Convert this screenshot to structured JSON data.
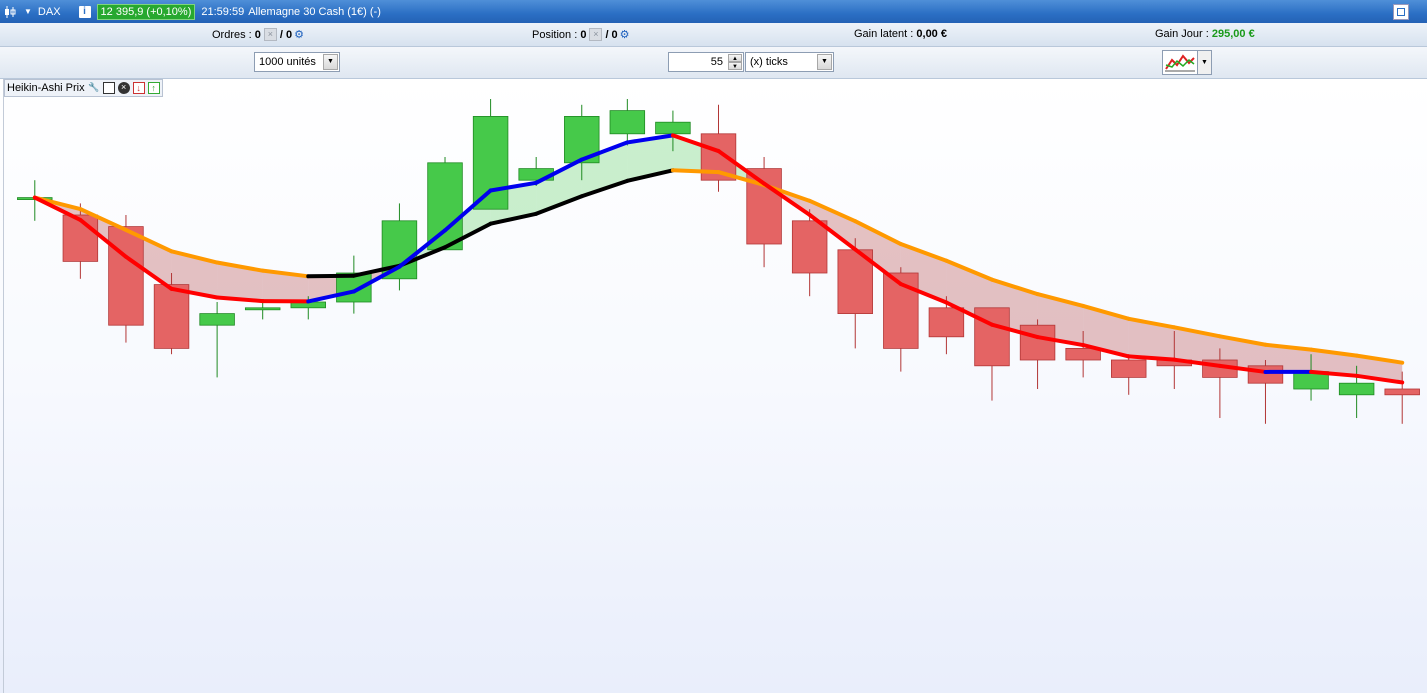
{
  "titlebar": {
    "symbol": "DAX",
    "info_icon": "i",
    "price_badge": "12 395,9 (+0,10%)",
    "clock": "21:59:59",
    "instrument": "Allemagne 30 Cash (1€) (-)"
  },
  "infobar": {
    "orders_label": "Ordres :",
    "orders_value": "0",
    "orders_value2": "/ 0",
    "position_label": "Position :",
    "position_value": "0",
    "position_value2": "/ 0",
    "latent_label": "Gain latent :",
    "latent_value": "0,00 €",
    "day_label": "Gain Jour :",
    "day_value": "295,00 €"
  },
  "toolbar": {
    "units_select": "1000 unités",
    "ticks_value": "55",
    "ticks_select": "(x) ticks"
  },
  "indicator": {
    "label": "Heikin-Ashi Prix"
  },
  "colors": {
    "bull": "#46c94a",
    "bear": "#e46464",
    "ma_fast_up": "#0000ee",
    "ma_fast_down": "#ff0000",
    "ma_slow_up": "#000000",
    "ma_slow_down": "#ff9900"
  },
  "chart_data": {
    "type": "candlestick",
    "candles": [
      {
        "o": 0.83,
        "c": 0.83,
        "h": 0.86,
        "l": 0.79
      },
      {
        "o": 0.8,
        "c": 0.72,
        "h": 0.82,
        "l": 0.69
      },
      {
        "o": 0.78,
        "c": 0.61,
        "h": 0.8,
        "l": 0.58
      },
      {
        "o": 0.68,
        "c": 0.57,
        "h": 0.7,
        "l": 0.56
      },
      {
        "o": 0.61,
        "c": 0.63,
        "h": 0.65,
        "l": 0.52
      },
      {
        "o": 0.64,
        "c": 0.64,
        "h": 0.65,
        "l": 0.62
      },
      {
        "o": 0.64,
        "c": 0.65,
        "h": 0.66,
        "l": 0.62
      },
      {
        "o": 0.65,
        "c": 0.7,
        "h": 0.73,
        "l": 0.63
      },
      {
        "o": 0.69,
        "c": 0.79,
        "h": 0.82,
        "l": 0.67
      },
      {
        "o": 0.74,
        "c": 0.89,
        "h": 0.9,
        "l": 0.74
      },
      {
        "o": 0.81,
        "c": 0.97,
        "h": 1.0,
        "l": 0.81
      },
      {
        "o": 0.86,
        "c": 0.88,
        "h": 0.9,
        "l": 0.85
      },
      {
        "o": 0.89,
        "c": 0.97,
        "h": 0.99,
        "l": 0.86
      },
      {
        "o": 0.94,
        "c": 0.98,
        "h": 1.0,
        "l": 0.92
      },
      {
        "o": 0.94,
        "c": 0.96,
        "h": 0.98,
        "l": 0.91
      },
      {
        "o": 0.94,
        "c": 0.86,
        "h": 0.99,
        "l": 0.84
      },
      {
        "o": 0.88,
        "c": 0.75,
        "h": 0.9,
        "l": 0.71
      },
      {
        "o": 0.79,
        "c": 0.7,
        "h": 0.81,
        "l": 0.66
      },
      {
        "o": 0.74,
        "c": 0.63,
        "h": 0.76,
        "l": 0.57
      },
      {
        "o": 0.7,
        "c": 0.57,
        "h": 0.71,
        "l": 0.53
      },
      {
        "o": 0.64,
        "c": 0.59,
        "h": 0.66,
        "l": 0.56
      },
      {
        "o": 0.64,
        "c": 0.54,
        "h": 0.64,
        "l": 0.48
      },
      {
        "o": 0.61,
        "c": 0.55,
        "h": 0.62,
        "l": 0.5
      },
      {
        "o": 0.57,
        "c": 0.55,
        "h": 0.6,
        "l": 0.52
      },
      {
        "o": 0.55,
        "c": 0.52,
        "h": 0.56,
        "l": 0.49
      },
      {
        "o": 0.55,
        "c": 0.54,
        "h": 0.6,
        "l": 0.5
      },
      {
        "o": 0.55,
        "c": 0.52,
        "h": 0.57,
        "l": 0.45
      },
      {
        "o": 0.54,
        "c": 0.51,
        "h": 0.55,
        "l": 0.44
      },
      {
        "o": 0.5,
        "c": 0.53,
        "h": 0.56,
        "l": 0.48
      },
      {
        "o": 0.49,
        "c": 0.51,
        "h": 0.54,
        "l": 0.45
      },
      {
        "o": 0.5,
        "c": 0.49,
        "h": 0.53,
        "l": 0.44
      }
    ],
    "title": "",
    "xlabel": "",
    "ylabel": "",
    "grid": false
  }
}
